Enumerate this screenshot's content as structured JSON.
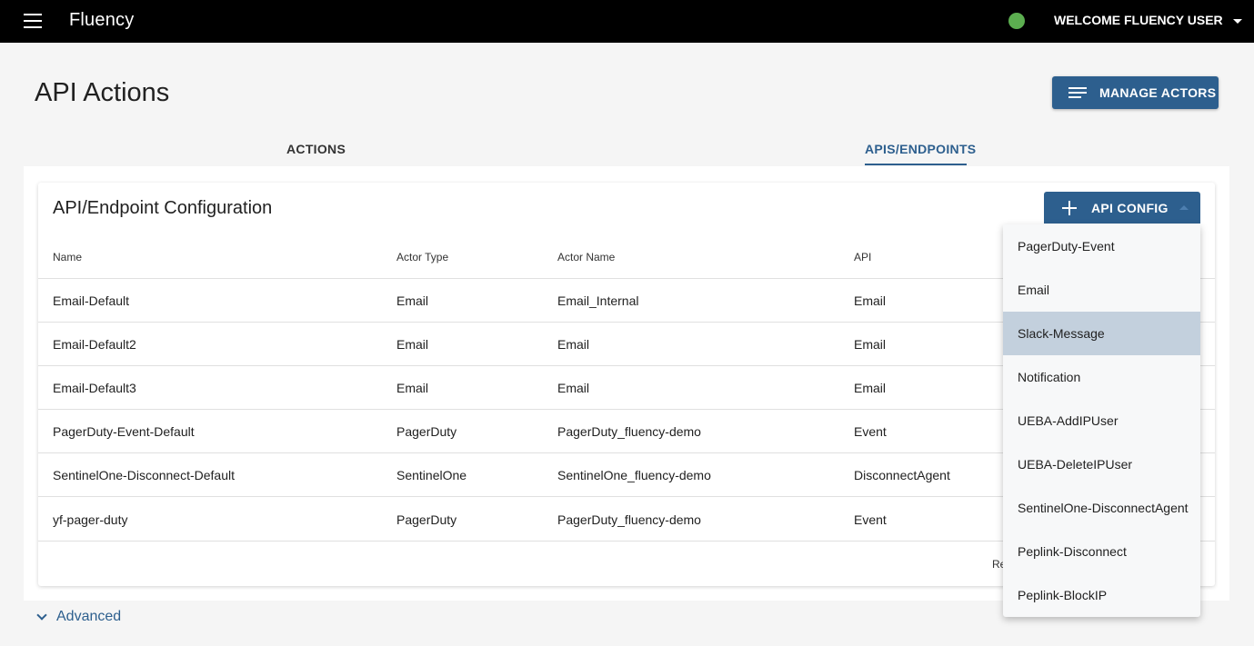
{
  "header": {
    "app_title": "Fluency",
    "user_label": "WELCOME FLUENCY USER",
    "status_color": "#5cae50"
  },
  "page": {
    "title": "API Actions",
    "manage_actors_label": "MANAGE ACTORS"
  },
  "tabs": [
    {
      "label": "ACTIONS",
      "active": false
    },
    {
      "label": "APIS/ENDPOINTS",
      "active": true
    }
  ],
  "card": {
    "title": "API/Endpoint Configuration",
    "api_config_label": "API CONFIG"
  },
  "table": {
    "columns": [
      "Name",
      "Actor Type",
      "Actor Name",
      "API"
    ],
    "rows": [
      [
        "Email-Default",
        "Email",
        "Email_Internal",
        "Email"
      ],
      [
        "Email-Default2",
        "Email",
        "Email",
        "Email"
      ],
      [
        "Email-Default3",
        "Email",
        "Email",
        "Email"
      ],
      [
        "PagerDuty-Event-Default",
        "PagerDuty",
        "PagerDuty_fluency-demo",
        "Event"
      ],
      [
        "SentinelOne-Disconnect-Default",
        "SentinelOne",
        "SentinelOne_fluency-demo",
        "DisconnectAgent"
      ],
      [
        "yf-pager-duty",
        "PagerDuty",
        "PagerDuty_fluency-demo",
        "Event"
      ]
    ],
    "footer_text": "Re"
  },
  "dropdown": {
    "items": [
      "PagerDuty-Event",
      "Email",
      "Slack-Message",
      "Notification",
      "UEBA-AddIPUser",
      "UEBA-DeleteIPUser",
      "SentinelOne-DisconnectAgent",
      "Peplink-Disconnect",
      "Peplink-BlockIP"
    ],
    "selected": "Slack-Message"
  },
  "advanced": {
    "label": "Advanced"
  },
  "colors": {
    "accent": "#2d5f8e",
    "topbar": "#000000",
    "selected_item": "#c3d0dd"
  }
}
